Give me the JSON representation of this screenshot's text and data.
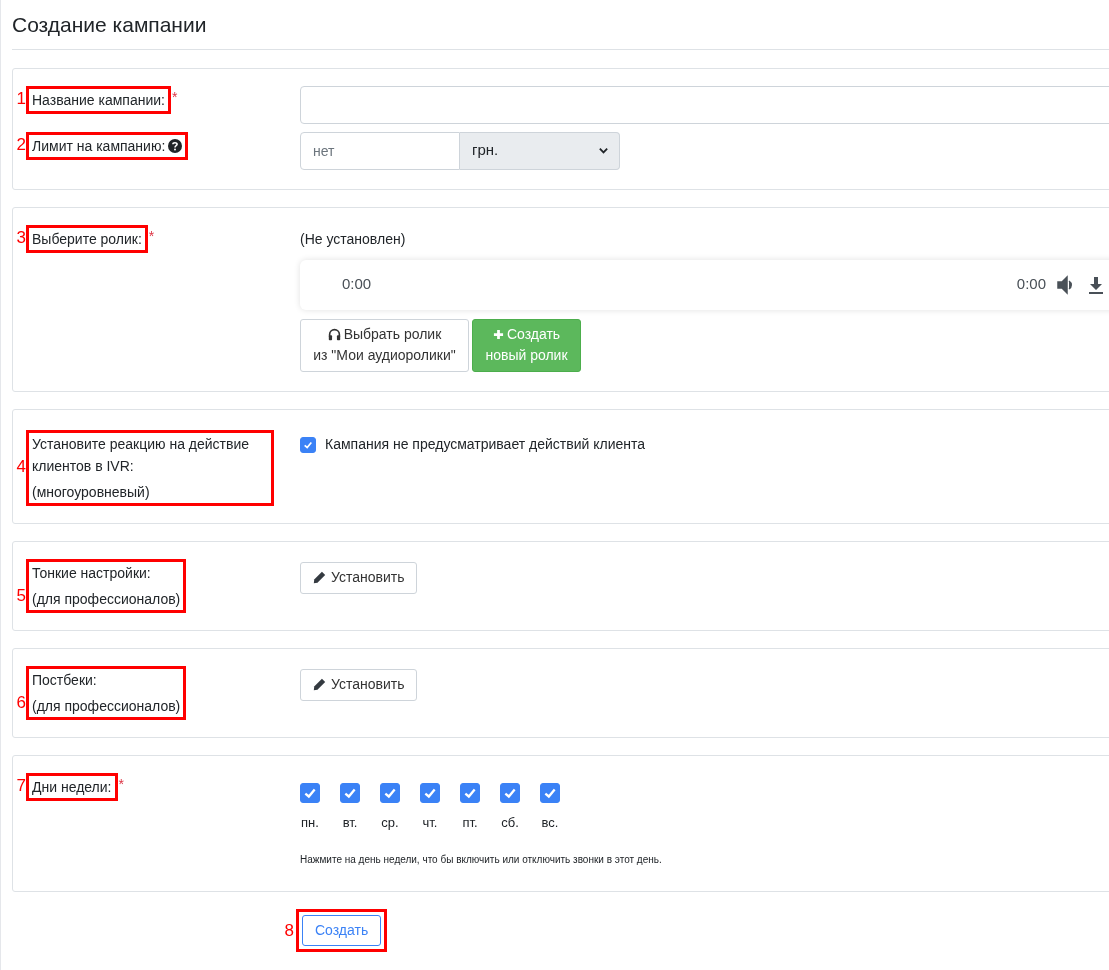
{
  "page_title": "Создание кампании",
  "sections": [
    {
      "kind": "general",
      "rows": [
        {
          "kind": "text_input",
          "annotation": "1",
          "label": "Название кампании:",
          "required_mark": "*"
        },
        {
          "kind": "limit",
          "annotation": "2",
          "label": "Лимит на кампанию:",
          "help": true,
          "placeholder": "нет",
          "currency": "грн."
        }
      ]
    },
    {
      "kind": "audio",
      "annotation": "3",
      "label": "Выберите ролик:",
      "required_mark": "*",
      "status": "(Не установлен)",
      "player": {
        "current": "0:00",
        "duration": "0:00"
      },
      "buttons": [
        {
          "kind": "choose",
          "lines": [
            "Выбрать ролик",
            "из \"Мои аудиоролики\""
          ]
        },
        {
          "kind": "create",
          "lines": [
            "Создать",
            "новый ролик"
          ]
        }
      ]
    },
    {
      "kind": "checkbox",
      "annotation": "4",
      "label": "Установите реакцию на действие клиентов в IVR:",
      "sublabel": "(многоуровневый)",
      "checkbox": {
        "label": "Кампания не предусматривает действий клиента",
        "checked": true
      }
    },
    {
      "kind": "edit",
      "annotation": "5",
      "label": "Тонкие настройки:",
      "sublabel": "(для профессионалов)",
      "button": "Установить"
    },
    {
      "kind": "edit",
      "annotation": "6",
      "label": "Постбеки:",
      "sublabel": "(для профессионалов)",
      "button": "Установить"
    },
    {
      "kind": "days",
      "annotation": "7",
      "label": "Дни недели:",
      "required_mark": "*",
      "days": [
        {
          "label": "пн.",
          "checked": true
        },
        {
          "label": "вт.",
          "checked": true
        },
        {
          "label": "ср.",
          "checked": true
        },
        {
          "label": "чт.",
          "checked": true
        },
        {
          "label": "пт.",
          "checked": true
        },
        {
          "label": "сб.",
          "checked": true
        },
        {
          "label": "вс.",
          "checked": true
        }
      ],
      "hint": "Нажмите на день недели, что бы включить или отключить звонки в этот день."
    }
  ],
  "submit": {
    "annotation": "8",
    "label": "Создать"
  }
}
